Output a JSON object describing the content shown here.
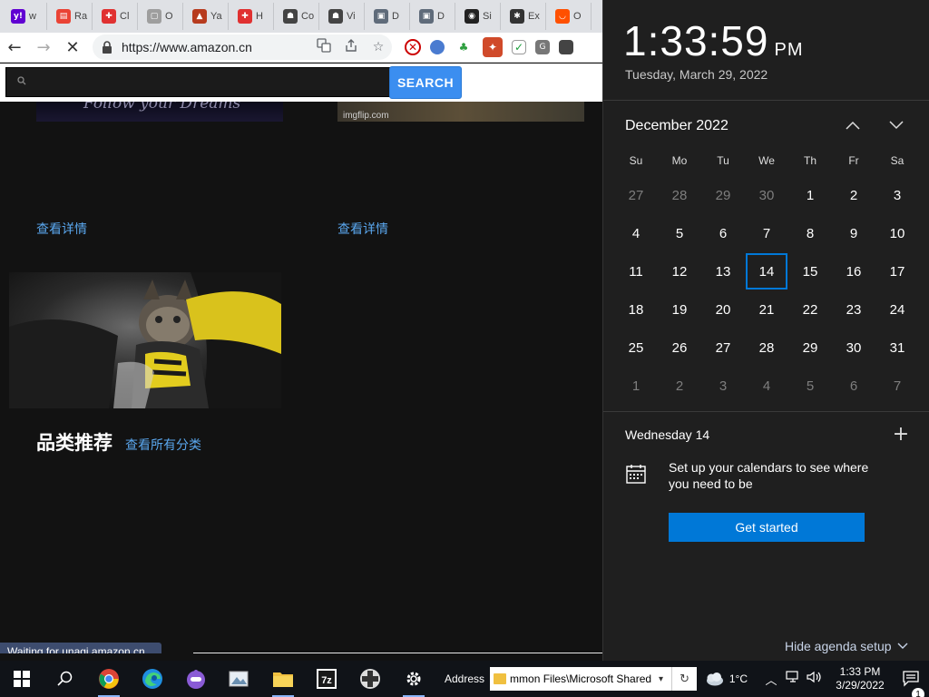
{
  "browser": {
    "tabs": [
      {
        "title": "w",
        "fav": "y!",
        "color": "#6001d2"
      },
      {
        "title": "Ra",
        "fav": "▤",
        "color": "#ea4335"
      },
      {
        "title": "Cl",
        "fav": "✚",
        "color": "#e03131"
      },
      {
        "title": "O",
        "fav": "▢",
        "color": "#9e9e9e"
      },
      {
        "title": "Ya",
        "fav": "▲",
        "color": "#b73b1e"
      },
      {
        "title": "H",
        "fav": "✚",
        "color": "#e03131"
      },
      {
        "title": "Co",
        "fav": "☗",
        "color": "#444444"
      },
      {
        "title": "Vi",
        "fav": "☗",
        "color": "#444444"
      },
      {
        "title": "D",
        "fav": "▣",
        "color": "#5f6b7a"
      },
      {
        "title": "D",
        "fav": "▣",
        "color": "#5f6b7a"
      },
      {
        "title": "Si",
        "fav": "◉",
        "color": "#222222"
      },
      {
        "title": "Ex",
        "fav": "✱",
        "color": "#333333"
      },
      {
        "title": "O",
        "fav": "◡",
        "color": "#ff5000"
      }
    ],
    "url": "https://www.amazon.cn",
    "search_placeholder": "",
    "search_button": "SEARCH",
    "promo1_text": "Follow your Dreams",
    "promo2_text": "imgflip.com",
    "detail_link": "查看详情",
    "category_title": "品类推荐",
    "category_all": "查看所有分类",
    "status": "Waiting for unagi.amazon.cn..."
  },
  "flyout": {
    "time": "1:33:59",
    "ampm": "PM",
    "date": "Tuesday, March 29, 2022",
    "month_label": "December 2022",
    "weekdays": [
      "Su",
      "Mo",
      "Tu",
      "We",
      "Th",
      "Fr",
      "Sa"
    ],
    "weeks": [
      [
        "27",
        "28",
        "29",
        "30",
        "1",
        "2",
        "3"
      ],
      [
        "4",
        "5",
        "6",
        "7",
        "8",
        "9",
        "10"
      ],
      [
        "11",
        "12",
        "13",
        "14",
        "15",
        "16",
        "17"
      ],
      [
        "18",
        "19",
        "20",
        "21",
        "22",
        "23",
        "24"
      ],
      [
        "25",
        "26",
        "27",
        "28",
        "29",
        "30",
        "31"
      ],
      [
        "1",
        "2",
        "3",
        "4",
        "5",
        "6",
        "7"
      ]
    ],
    "selected_day": "14",
    "agenda_date": "Wednesday 14",
    "agenda_message": "Set up your calendars to see where you need to be",
    "get_started": "Get started",
    "hide_agenda": "Hide agenda setup"
  },
  "taskbar": {
    "address_label": "Address",
    "address_path": "mmon Files\\Microsoft Shared",
    "weather_temp": "1°C",
    "clock_time": "1:33 PM",
    "clock_date": "3/29/2022",
    "notification_count": "1"
  },
  "colors": {
    "accent": "#0078d7",
    "link": "#5aa7ee",
    "search_button": "#3b8ef0"
  }
}
